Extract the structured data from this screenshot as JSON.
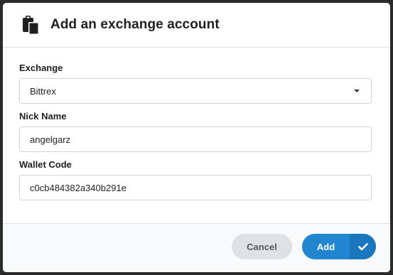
{
  "dialog": {
    "title": "Add an exchange account",
    "title_icon": "clipboard-paste-icon"
  },
  "form": {
    "exchange": {
      "label": "Exchange",
      "selected": "Bittrex"
    },
    "nick_name": {
      "label": "Nick Name",
      "value": "angelgarz"
    },
    "wallet_code": {
      "label": "Wallet Code",
      "value": "c0cb484382a340b291e"
    }
  },
  "footer": {
    "cancel_label": "Cancel",
    "add_label": "Add",
    "add_icon": "checkmark-icon"
  },
  "colors": {
    "primary": "#2185d0",
    "cancel_bg": "#e0e1e2"
  }
}
